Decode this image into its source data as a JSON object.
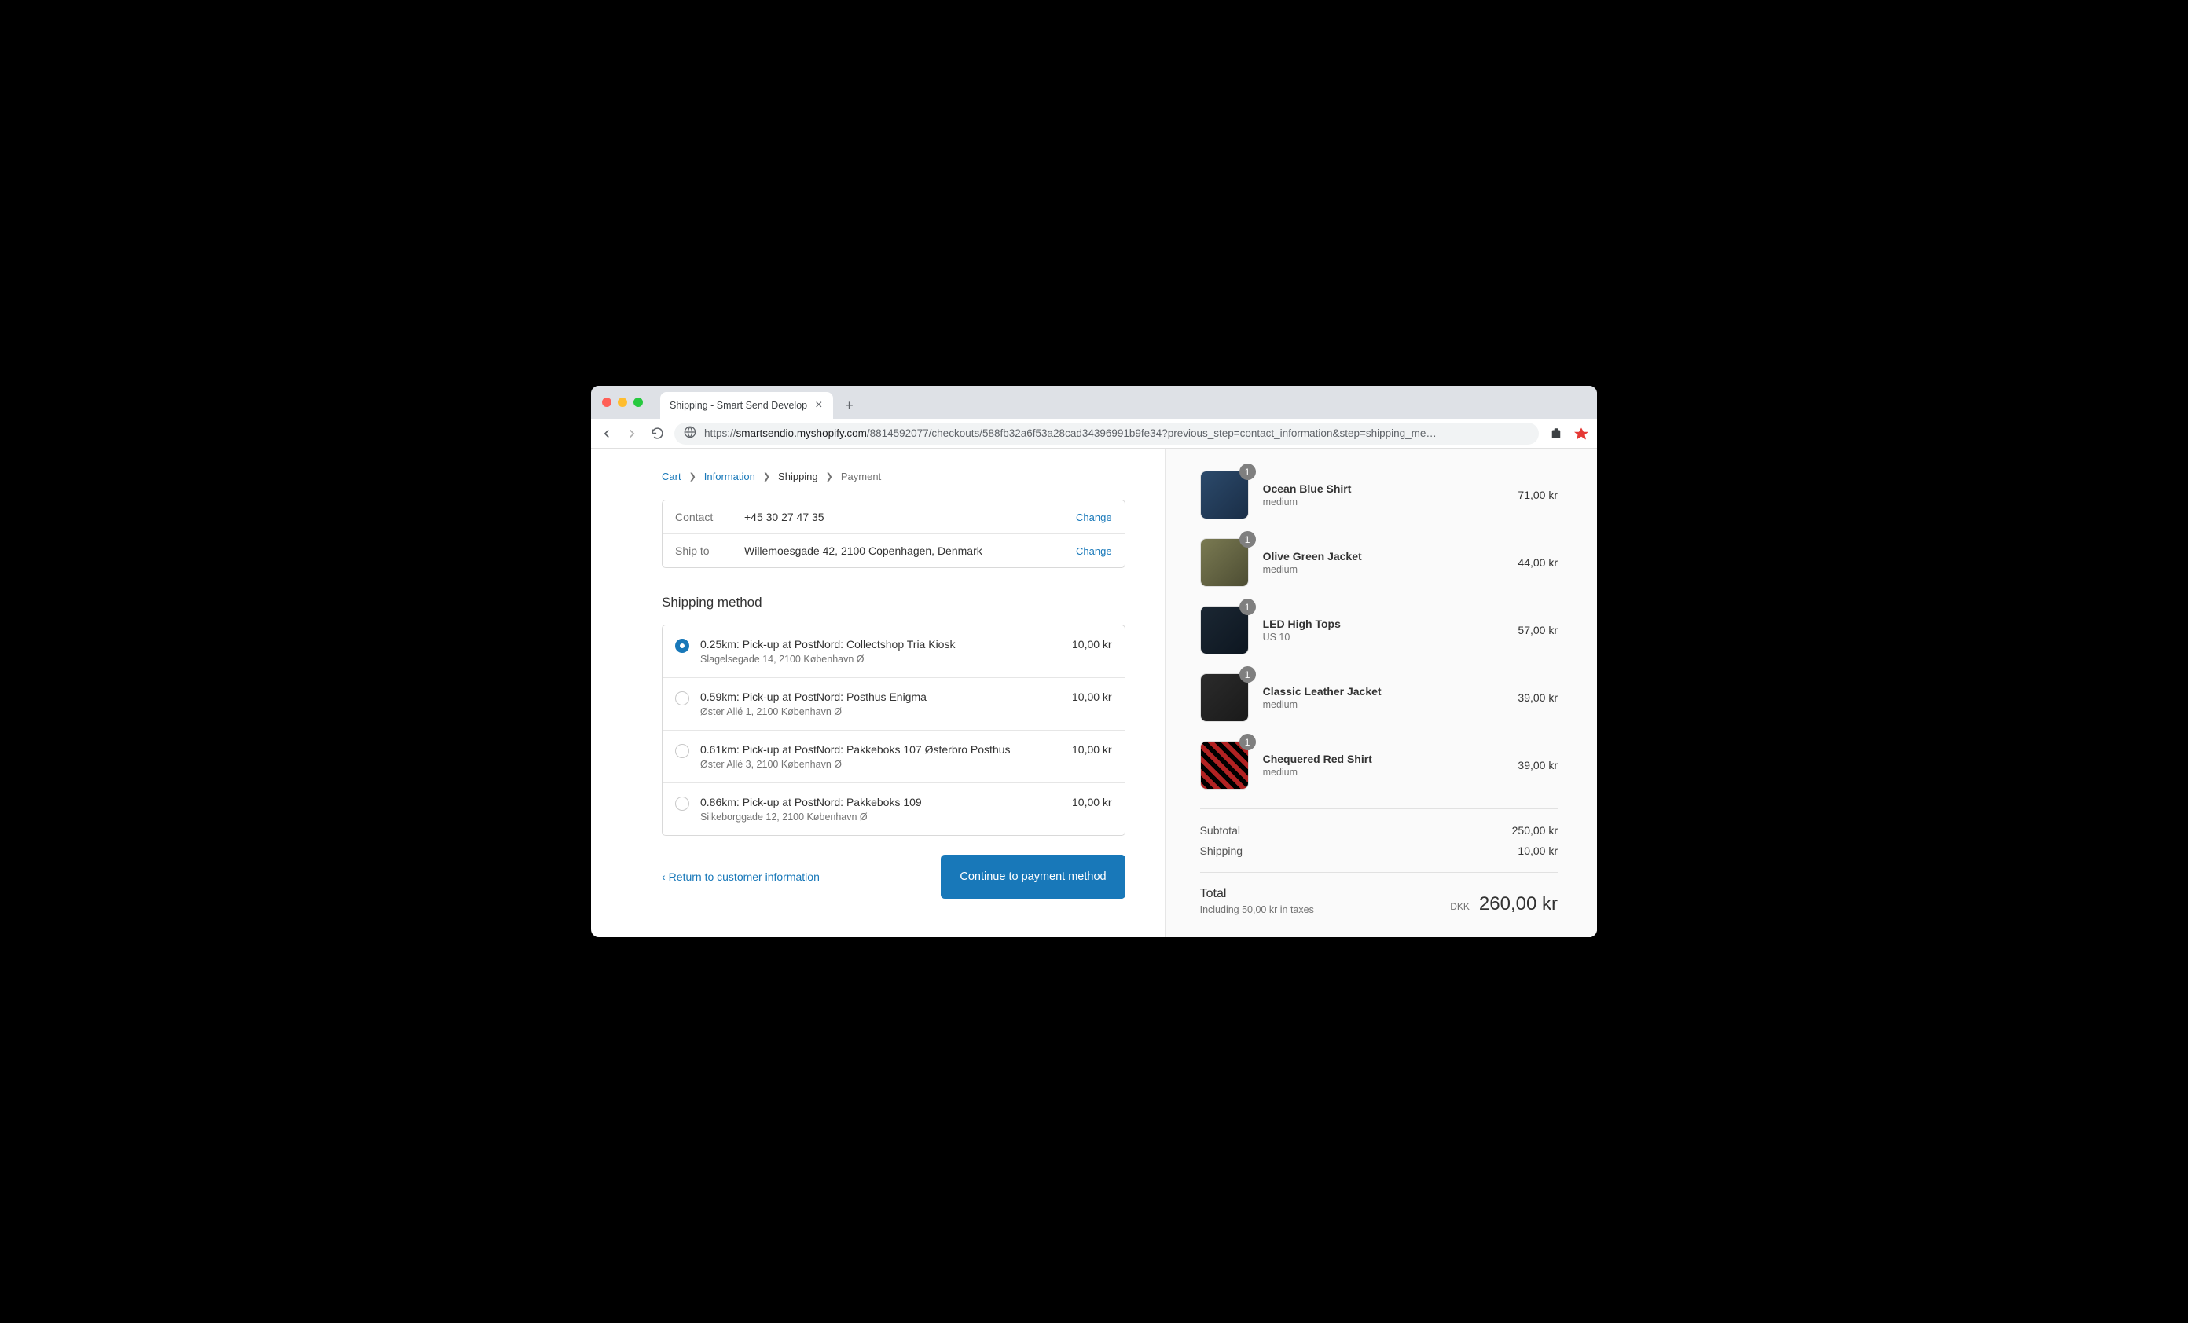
{
  "browser": {
    "tab_title": "Shipping - Smart Send Develop",
    "url_prefix": "https://",
    "url_domain": "smartsendio.myshopify.com",
    "url_path": "/8814592077/checkouts/588fb32a6f53a28cad34396991b9fe34?previous_step=contact_information&step=shipping_me…"
  },
  "breadcrumb": {
    "cart": "Cart",
    "info": "Information",
    "shipping": "Shipping",
    "payment": "Payment"
  },
  "review": {
    "contact_label": "Contact",
    "contact_value": "+45 30 27 47 35",
    "shipto_label": "Ship to",
    "shipto_value": "Willemoesgade 42, 2100 Copenhagen, Denmark",
    "change": "Change"
  },
  "shipping_heading": "Shipping method",
  "shipping_options": [
    {
      "title": "0.25km: Pick-up at PostNord: Collectshop Tria Kiosk",
      "sub": "Slagelsegade 14, 2100 København Ø",
      "price": "10,00 kr",
      "selected": true
    },
    {
      "title": "0.59km: Pick-up at PostNord: Posthus Enigma",
      "sub": "Øster Allé 1, 2100 København Ø",
      "price": "10,00 kr",
      "selected": false
    },
    {
      "title": "0.61km: Pick-up at PostNord: Pakkeboks 107 Østerbro Posthus",
      "sub": "Øster Allé 3, 2100 København Ø",
      "price": "10,00 kr",
      "selected": false
    },
    {
      "title": "0.86km: Pick-up at PostNord: Pakkeboks 109",
      "sub": "Silkeborggade 12, 2100 København Ø",
      "price": "10,00 kr",
      "selected": false
    }
  ],
  "actions": {
    "back": "Return to customer information",
    "continue": "Continue to payment method"
  },
  "cart": {
    "items": [
      {
        "name": "Ocean Blue Shirt",
        "variant": "medium",
        "qty": "1",
        "price": "71,00 kr",
        "swatch": "sw-blue"
      },
      {
        "name": "Olive Green Jacket",
        "variant": "medium",
        "qty": "1",
        "price": "44,00 kr",
        "swatch": "sw-olive"
      },
      {
        "name": "LED High Tops",
        "variant": "US 10",
        "qty": "1",
        "price": "57,00 kr",
        "swatch": "sw-led"
      },
      {
        "name": "Classic Leather Jacket",
        "variant": "medium",
        "qty": "1",
        "price": "39,00 kr",
        "swatch": "sw-leather"
      },
      {
        "name": "Chequered Red Shirt",
        "variant": "medium",
        "qty": "1",
        "price": "39,00 kr",
        "swatch": "sw-red"
      }
    ],
    "subtotal_label": "Subtotal",
    "subtotal_value": "250,00 kr",
    "shipping_label": "Shipping",
    "shipping_value": "10,00 kr",
    "total_label": "Total",
    "tax_note": "Including 50,00 kr in taxes",
    "currency": "DKK",
    "total_value": "260,00 kr"
  }
}
